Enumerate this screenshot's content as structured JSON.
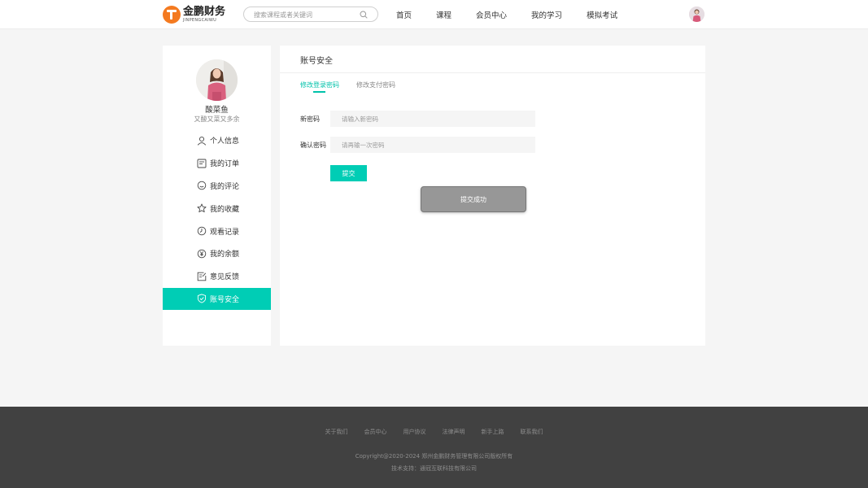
{
  "header": {
    "logo_cn": "金鹏财务",
    "logo_en": "JINPENGCAIWU",
    "search_placeholder": "搜索课程或者关键词",
    "nav": [
      "首页",
      "课程",
      "会员中心",
      "我的学习",
      "模拟考试"
    ]
  },
  "sidebar": {
    "name": "酸菜鱼",
    "signature": "又酸又菜又多余",
    "menu": [
      {
        "label": "个人信息",
        "icon": "user-icon"
      },
      {
        "label": "我的订单",
        "icon": "order-icon"
      },
      {
        "label": "我的评论",
        "icon": "comment-icon"
      },
      {
        "label": "我的收藏",
        "icon": "star-icon"
      },
      {
        "label": "观看记录",
        "icon": "clock-icon"
      },
      {
        "label": "我的余额",
        "icon": "yen-icon"
      },
      {
        "label": "意见反馈",
        "icon": "feedback-icon"
      },
      {
        "label": "账号安全",
        "icon": "shield-icon"
      }
    ],
    "active_index": 7
  },
  "panel": {
    "title": "账号安全",
    "tabs": [
      "修改登录密码",
      "修改支付密码"
    ],
    "new_password_label": "新密码",
    "new_password_placeholder": "请输入新密码",
    "confirm_password_label": "确认密码",
    "confirm_password_placeholder": "请再输一次密码",
    "submit_label": "提交",
    "toast_text": "提交成功"
  },
  "footer": {
    "links": [
      "关于我们",
      "会员中心",
      "用户协议",
      "法律声明",
      "新手上路",
      "联系我们"
    ],
    "copyright": "Copyright@2020-2024 郑州金鹏财务管理有限公司版权所有",
    "support": "技术支持：通冠互联科技有限公司"
  },
  "colors": {
    "accent": "#00cdb5",
    "logo_orange": "#f47a20",
    "footer_bg": "#414141"
  }
}
